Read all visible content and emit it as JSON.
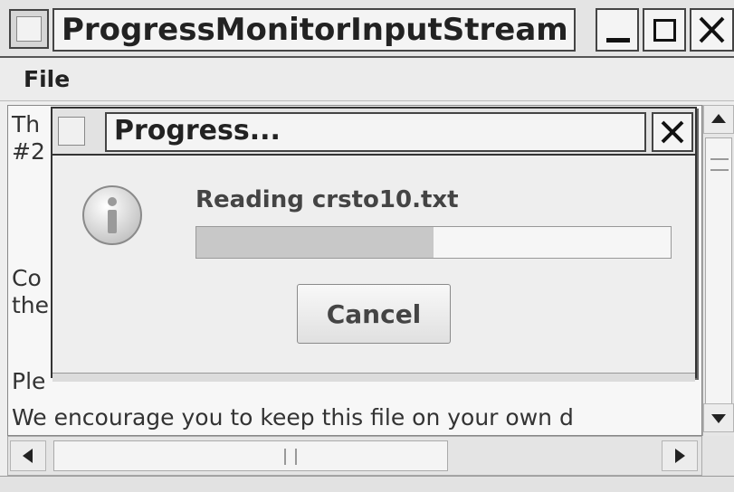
{
  "window": {
    "title": "ProgressMonitorInputStream",
    "icons": {
      "app": "java-app-icon",
      "minimize": "minimize-icon",
      "maximize": "maximize-icon",
      "close": "close-icon"
    }
  },
  "menu": {
    "items": [
      "File"
    ]
  },
  "text_area": {
    "lines": [
      "Th",
      "#2",
      "",
      "",
      "Co",
      "the",
      "",
      "Ple",
      "We encourage you to keep this file on your own d"
    ]
  },
  "dialog": {
    "title": "Progress...",
    "message": "Reading crsto10.txt",
    "progress": 0.5,
    "cancel_label": "Cancel",
    "icon": "info-icon"
  },
  "colors": {
    "background": "#eeeeee",
    "progress_fill": "#c8c8c8",
    "border": "#333333"
  }
}
